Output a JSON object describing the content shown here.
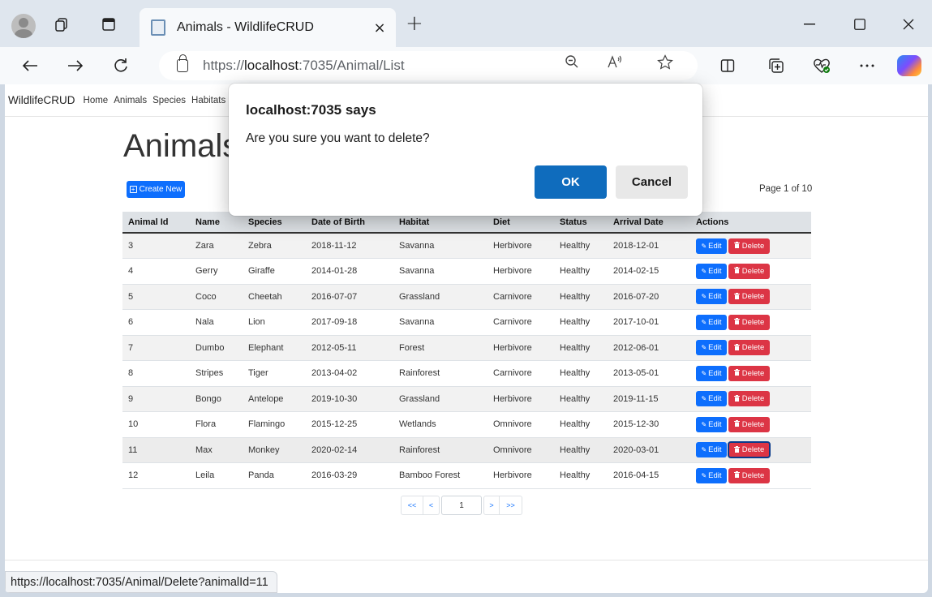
{
  "browser": {
    "tab_title": "Animals - WildlifeCRUD",
    "tab_close": "×",
    "new_tab": "+",
    "url_prefix": "https://",
    "url_host": "localhost",
    "url_rest": ":7035/Animal/List"
  },
  "app": {
    "brand": "WildlifeCRUD",
    "nav": [
      "Home",
      "Animals",
      "Species",
      "Habitats"
    ]
  },
  "page": {
    "title": "Animals",
    "create_label": "Create New",
    "page_info": "Page 1 of 10"
  },
  "table": {
    "headers": [
      "Animal Id",
      "Name",
      "Species",
      "Date of Birth",
      "Habitat",
      "Diet",
      "Status",
      "Arrival Date",
      "Actions"
    ],
    "edit_label": "Edit",
    "delete_label": "Delete",
    "rows": [
      [
        "3",
        "Zara",
        "Zebra",
        "2018-11-12",
        "Savanna",
        "Herbivore",
        "Healthy",
        "2018-12-01"
      ],
      [
        "4",
        "Gerry",
        "Giraffe",
        "2014-01-28",
        "Savanna",
        "Herbivore",
        "Healthy",
        "2014-02-15"
      ],
      [
        "5",
        "Coco",
        "Cheetah",
        "2016-07-07",
        "Grassland",
        "Carnivore",
        "Healthy",
        "2016-07-20"
      ],
      [
        "6",
        "Nala",
        "Lion",
        "2017-09-18",
        "Savanna",
        "Carnivore",
        "Healthy",
        "2017-10-01"
      ],
      [
        "7",
        "Dumbo",
        "Elephant",
        "2012-05-11",
        "Forest",
        "Herbivore",
        "Healthy",
        "2012-06-01"
      ],
      [
        "8",
        "Stripes",
        "Tiger",
        "2013-04-02",
        "Rainforest",
        "Carnivore",
        "Healthy",
        "2013-05-01"
      ],
      [
        "9",
        "Bongo",
        "Antelope",
        "2019-10-30",
        "Grassland",
        "Herbivore",
        "Healthy",
        "2019-11-15"
      ],
      [
        "10",
        "Flora",
        "Flamingo",
        "2015-12-25",
        "Wetlands",
        "Omnivore",
        "Healthy",
        "2015-12-30"
      ],
      [
        "11",
        "Max",
        "Monkey",
        "2020-02-14",
        "Rainforest",
        "Omnivore",
        "Healthy",
        "2020-03-01"
      ],
      [
        "12",
        "Leila",
        "Panda",
        "2016-03-29",
        "Bamboo Forest",
        "Herbivore",
        "Healthy",
        "2016-04-15"
      ]
    ],
    "hovered_row_index": 8
  },
  "pager": {
    "first": "<<",
    "prev": "<",
    "current": "1",
    "next": ">",
    "last": ">>"
  },
  "dialog": {
    "title": "localhost:7035 says",
    "message": "Are you sure you want to delete?",
    "ok": "OK",
    "cancel": "Cancel"
  },
  "status_url": "https://localhost:7035/Animal/Delete?animalId=11",
  "colors": {
    "primary": "#0d6efd",
    "danger": "#dc3545",
    "dialog_ok": "#0f6cbd"
  }
}
